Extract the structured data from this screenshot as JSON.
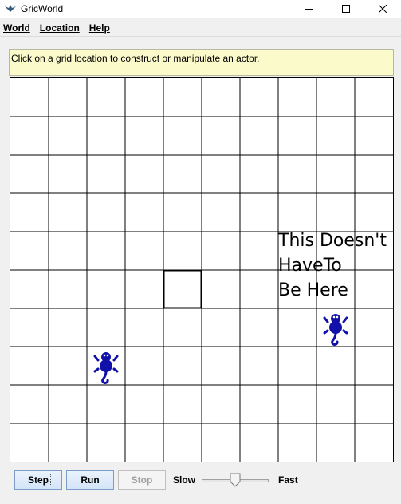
{
  "window": {
    "title": "GricWorld",
    "app_icon": "bug-icon",
    "controls": [
      "minimize-icon",
      "maximize-icon",
      "close-icon"
    ]
  },
  "menu": {
    "items": [
      {
        "label": "World"
      },
      {
        "label": "Location"
      },
      {
        "label": "Help"
      }
    ]
  },
  "message": "Click on a grid location to construct or manipulate an actor.",
  "grid": {
    "rows": 10,
    "cols": 10,
    "selected_cell": {
      "row": 5,
      "col": 4
    },
    "actors": [
      {
        "type": "critter",
        "row": 7,
        "col": 2,
        "color": "#1111aa",
        "icon": "critter-icon"
      },
      {
        "type": "critter",
        "row": 6,
        "col": 8,
        "color": "#1111aa",
        "icon": "critter-icon"
      }
    ],
    "overlay_text": [
      "This Doesn't",
      "HaveTo",
      "Be Here"
    ]
  },
  "controls": {
    "step_label": "Step",
    "run_label": "Run",
    "stop_label": "Stop",
    "stop_enabled": false,
    "slow_label": "Slow",
    "fast_label": "Fast",
    "speed": 0.5
  },
  "colors": {
    "message_bg": "#fafaca",
    "button_border": "#7a9cc6",
    "actor": "#1111aa"
  }
}
